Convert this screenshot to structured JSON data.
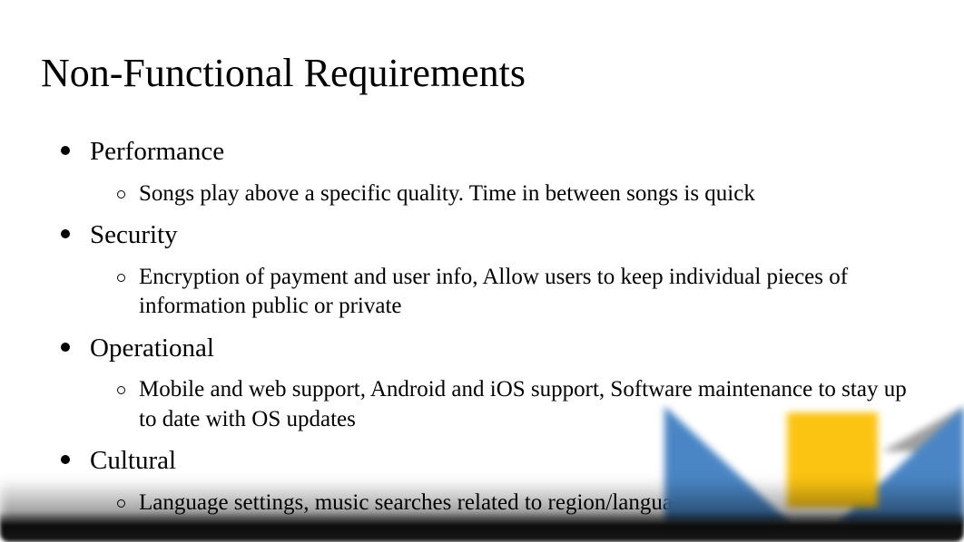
{
  "slide": {
    "title": "Non-Functional Requirements",
    "items": [
      {
        "label": "Performance",
        "subitems": [
          "Songs play above a specific quality. Time in between songs is quick"
        ]
      },
      {
        "label": "Security",
        "subitems": [
          "Encryption of payment and user info, Allow users to keep individual pieces of information public or private"
        ]
      },
      {
        "label": "Operational",
        "subitems": [
          "Mobile and web support, Android and iOS support, Software maintenance to stay up to date with OS updates"
        ]
      },
      {
        "label": "Cultural",
        "subitems": [
          "Language settings, music searches related to region/language,"
        ]
      }
    ]
  }
}
